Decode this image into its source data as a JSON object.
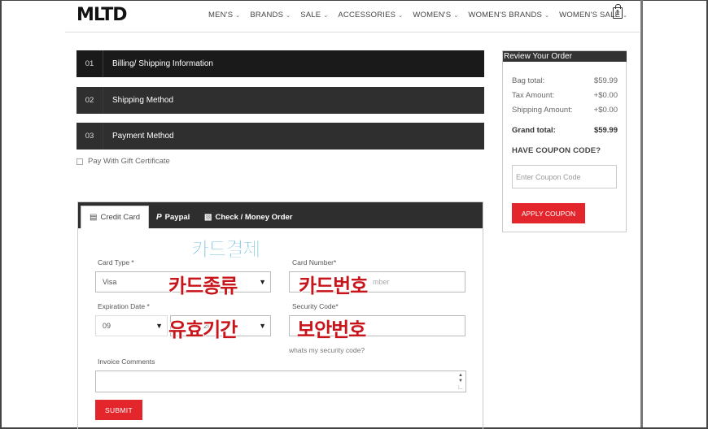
{
  "header": {
    "logo": "MLTD",
    "nav": [
      "MEN'S",
      "BRANDS",
      "SALE",
      "ACCESSORIES",
      "WOMEN'S",
      "WOMEN'S BRANDS",
      "WOMEN'S SALE"
    ],
    "bag_count": "1"
  },
  "steps": [
    {
      "num": "01",
      "label": "Billing/ Shipping Information"
    },
    {
      "num": "02",
      "label": "Shipping Method"
    },
    {
      "num": "03",
      "label": "Payment Method"
    }
  ],
  "gift_label": "Pay With Gift Certificate",
  "tabs": {
    "credit": "Credit Card",
    "paypal": "Paypal",
    "check": "Check / Money Order"
  },
  "annotations": {
    "payment": "카드결제",
    "card_type": "카드종류",
    "card_number": "카드번호",
    "expiration": "유효기간",
    "security": "보안번호"
  },
  "form": {
    "card_type_label": "Card Type *",
    "card_type_value": "Visa",
    "card_number_label": "Card Number*",
    "card_number_placeholder": "mber",
    "expiration_label": "Expiration Date *",
    "expiration_month": "09",
    "expiration_year": "20",
    "security_label": "Security Code*",
    "security_help": "whats my security code?",
    "comments_label": "Invoice Comments",
    "submit": "SUBMIT"
  },
  "review": {
    "title": "Review Your Order",
    "bag_total_label": "Bag total:",
    "bag_total_value": "$59.99",
    "tax_label": "Tax Amount:",
    "tax_value": "+$0.00",
    "shipping_label": "Shipping Amount:",
    "shipping_value": "+$0.00",
    "grand_label": "Grand total:",
    "grand_value": "$59.99",
    "coupon_title": "HAVE COUPON CODE?",
    "coupon_placeholder": "Enter Coupon Code",
    "coupon_button": "APPLY COUPON"
  },
  "colors": {
    "accent_red": "#e2262b",
    "annotation_blue": "#2ea0c8",
    "annotation_red": "#c8151b",
    "dark_bar": "#1a1a1a"
  }
}
